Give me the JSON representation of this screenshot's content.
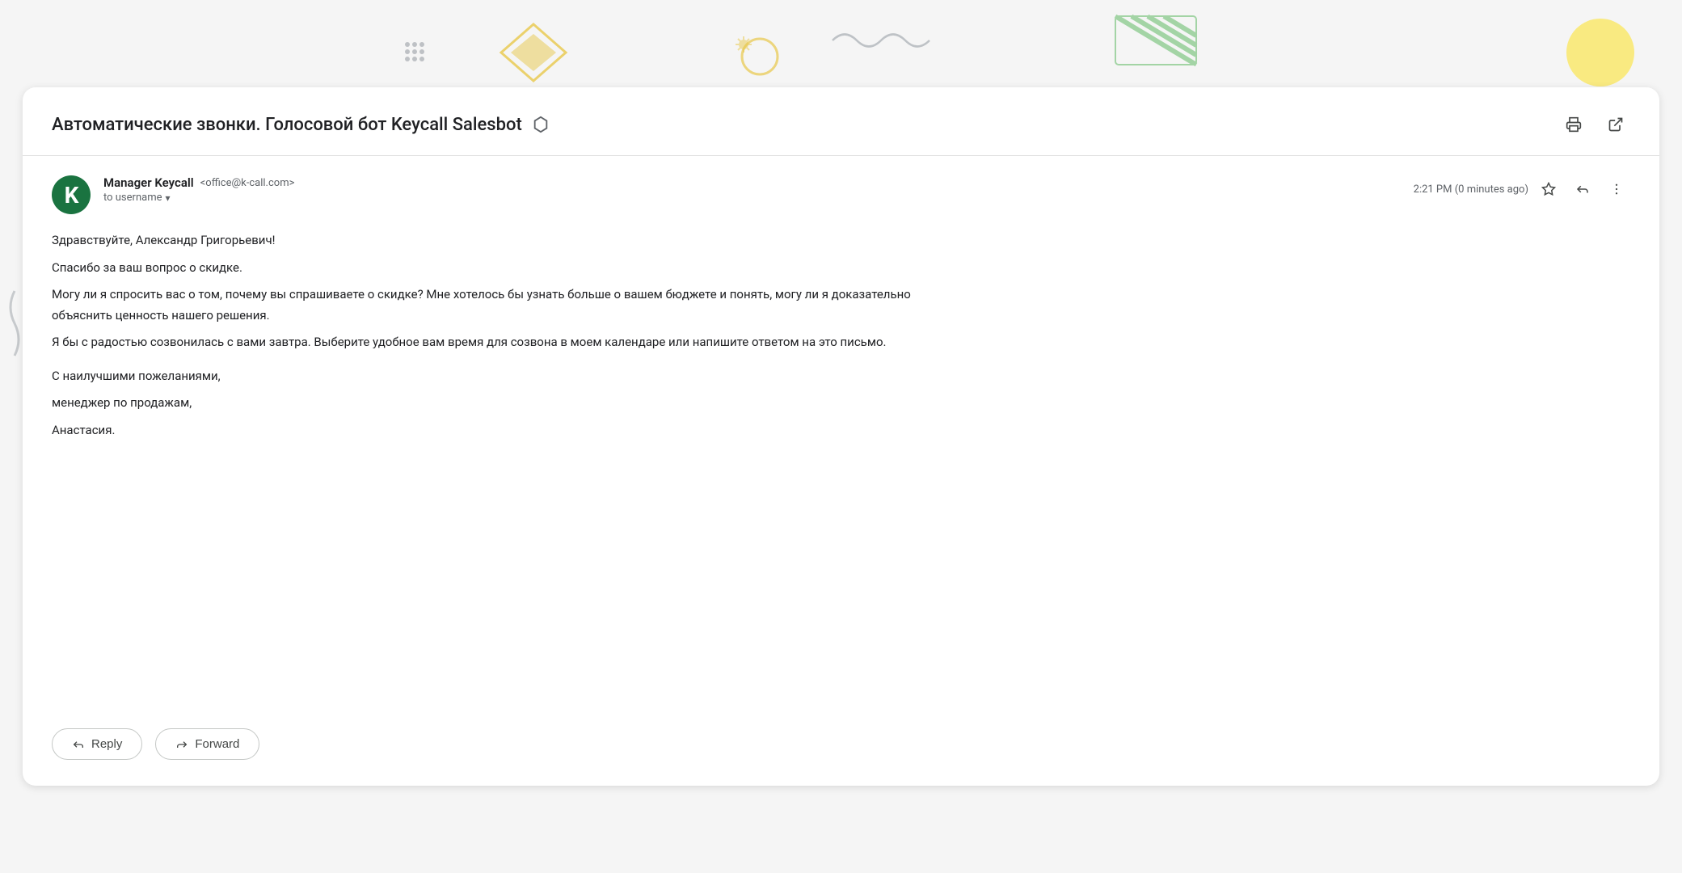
{
  "background": {
    "color": "#f5f5f5"
  },
  "email": {
    "subject": "Автоматические звонки. Голосовой бот Keycall Salesbot",
    "sender_name": "Manager Keycall",
    "sender_email": "<office@k-call.com>",
    "recipient_label": "to username",
    "timestamp": "2:21 PM (0 minutes ago)",
    "body_lines": [
      "Здравствуйте, Александр Григорьевич!",
      "Спасибо за ваш вопрос о скидке.",
      "Могу ли я спросить вас о том, почему вы спрашиваете о скидке? Мне хотелось бы узнать больше о вашем бюджете и понять, могу ли я доказательно объяснить ценность нашего решения.",
      "Я бы с радостью созвонилась с вами завтра. Выберите удобное вам время для созвона в моем календаре или напишите ответом на это письмо."
    ],
    "signature_lines": [
      "С наилучшими пожеланиями,",
      "менеджер по продажам,",
      "Анастасия."
    ],
    "buttons": {
      "reply": "Reply",
      "forward": "Forward"
    }
  }
}
